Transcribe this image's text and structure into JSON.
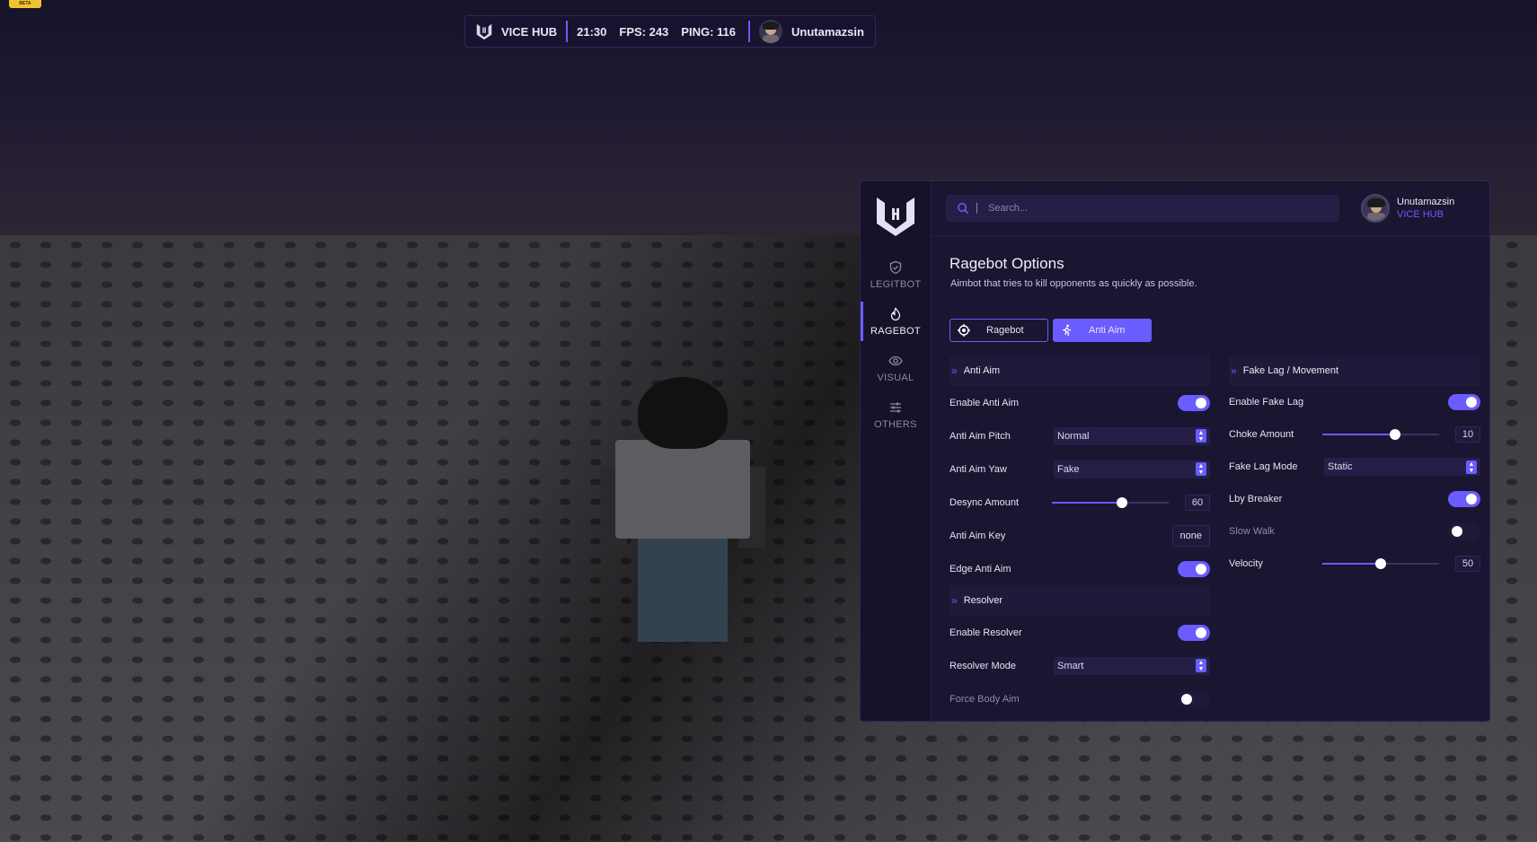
{
  "badge": "BETA",
  "hud": {
    "app_name": "VICE HUB",
    "time": "21:30",
    "fps": "FPS: 243",
    "ping": "PING: 116",
    "username": "Unutamazsin"
  },
  "sidebar": {
    "items": [
      {
        "label": "LEGITBOT",
        "icon": "shield-check-icon",
        "active": false
      },
      {
        "label": "RAGEBOT",
        "icon": "flame-icon",
        "active": true
      },
      {
        "label": "VISUAL",
        "icon": "eye-icon",
        "active": false
      },
      {
        "label": "OTHERS",
        "icon": "sliders-icon",
        "active": false
      }
    ]
  },
  "search": {
    "placeholder": "Search..."
  },
  "user": {
    "name": "Unutamazsin",
    "subtitle": "VICE HUB"
  },
  "page": {
    "title": "Ragebot Options",
    "description": "Aimbot that tries to kill opponents as quickly as possible."
  },
  "tabs": [
    {
      "label": "Ragebot",
      "active": false
    },
    {
      "label": "Anti Aim",
      "active": true
    }
  ],
  "anti_aim": {
    "title": "Anti Aim",
    "enable_label": "Enable Anti Aim",
    "enable_value": true,
    "pitch_label": "Anti Aim Pitch",
    "pitch_value": "Normal",
    "yaw_label": "Anti Aim Yaw",
    "yaw_value": "Fake",
    "desync_label": "Desync Amount",
    "desync_value": "60",
    "desync_fraction": 0.6,
    "key_label": "Anti Aim Key",
    "key_value": "none",
    "edge_label": "Edge Anti Aim",
    "edge_value": true
  },
  "resolver": {
    "title": "Resolver",
    "enable_label": "Enable Resolver",
    "enable_value": true,
    "mode_label": "Resolver Mode",
    "mode_value": "Smart",
    "force_label": "Force Body Aim",
    "force_value": false
  },
  "fake_lag": {
    "title": "Fake Lag / Movement",
    "enable_label": "Enable Fake Lag",
    "enable_value": true,
    "choke_label": "Choke Amount",
    "choke_value": "10",
    "choke_fraction": 0.62,
    "mode_label": "Fake Lag Mode",
    "mode_value": "Static",
    "lby_label": "Lby Breaker",
    "lby_value": true,
    "slow_walk_label": "Slow Walk",
    "slow_walk_value": false,
    "velocity_label": "Velocity",
    "velocity_value": "50",
    "velocity_fraction": 0.5
  },
  "colors": {
    "accent": "#6a5cff",
    "panel_bg": "#1a1531",
    "sidebar_bg": "#161229"
  }
}
